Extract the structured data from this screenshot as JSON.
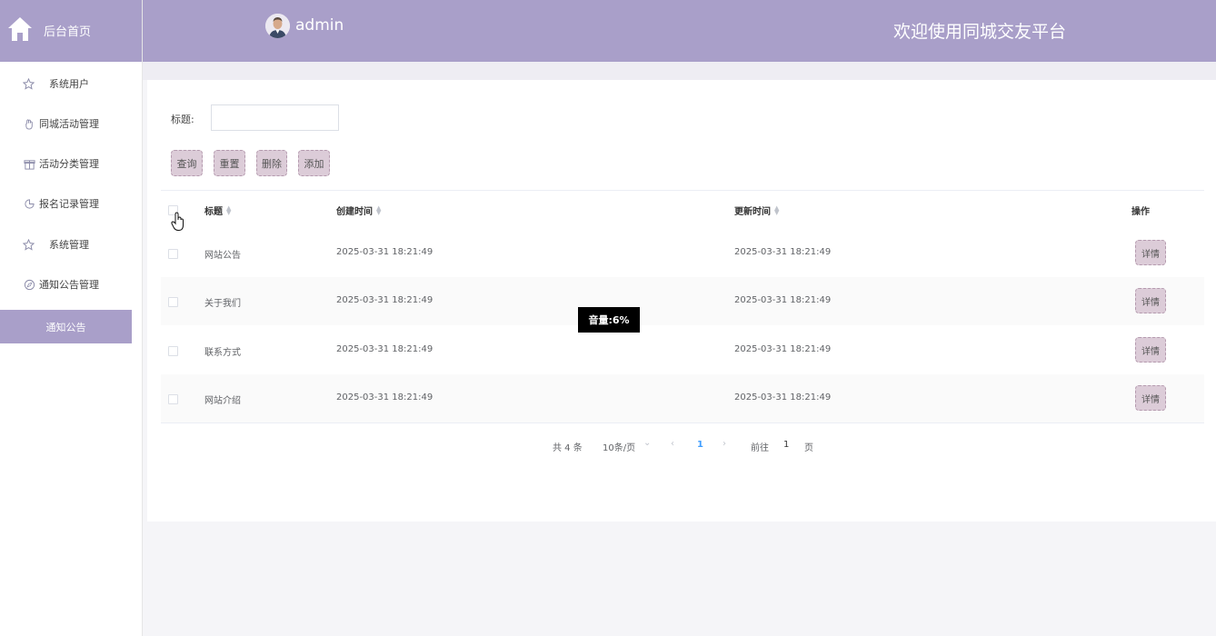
{
  "sidebar": {
    "home_label": "后台首页",
    "items": [
      {
        "label": "系统用户",
        "icon": "star-icon"
      },
      {
        "label": "同城活动管理",
        "icon": "hand-icon"
      },
      {
        "label": "活动分类管理",
        "icon": "gift-icon"
      },
      {
        "label": "报名记录管理",
        "icon": "pie-icon"
      },
      {
        "label": "系统管理",
        "icon": "star-icon"
      },
      {
        "label": "通知公告管理",
        "icon": "compass-icon"
      },
      {
        "label": "通知公告",
        "active": true
      }
    ]
  },
  "header": {
    "user": "admin",
    "welcome": "欢迎使用同城交友平台",
    "bg_color": "#a99fc9"
  },
  "filter": {
    "title_label": "标题:",
    "title_value": "",
    "title_placeholder": ""
  },
  "buttons": {
    "query": "查询",
    "reset": "重置",
    "delete": "删除",
    "add": "添加"
  },
  "table": {
    "columns": [
      "标题",
      "创建时间",
      "更新时间",
      "操作"
    ],
    "rows": [
      {
        "title": "网站公告",
        "created": "2025-03-31 18:21:49",
        "updated": "2025-03-31 18:21:49",
        "action": "详情"
      },
      {
        "title": "关于我们",
        "created": "2025-03-31 18:21:49",
        "updated": "2025-03-31 18:21:49",
        "action": "详情"
      },
      {
        "title": "联系方式",
        "created": "2025-03-31 18:21:49",
        "updated": "2025-03-31 18:21:49",
        "action": "详情"
      },
      {
        "title": "网站介绍",
        "created": "2025-03-31 18:21:49",
        "updated": "2025-03-31 18:21:49",
        "action": "详情"
      }
    ]
  },
  "pagination": {
    "total": "共 4 条",
    "page_size": "10条/页",
    "current_page": "1",
    "goto_label": "前往",
    "goto_value": "1",
    "page_suffix": "页"
  },
  "tooltip": {
    "text": "音量:6%"
  }
}
